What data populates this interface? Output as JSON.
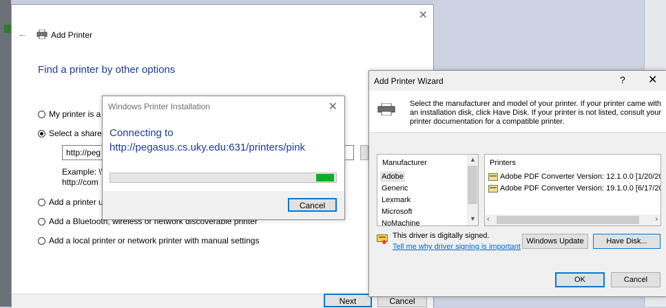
{
  "add_printer": {
    "title": "Add Printer",
    "heading": "Find a printer by other options",
    "options": [
      {
        "label": "My printer is a",
        "selected": false
      },
      {
        "label": "Select a shared",
        "selected": true
      },
      {
        "label": "Add a printer u",
        "selected": false
      },
      {
        "label": "Add a Bluetooth, wireless or network discoverable printer",
        "selected": false
      },
      {
        "label": "Add a local printer or network printer with manual settings",
        "selected": false
      }
    ],
    "url_value": "http://peg",
    "example_line1": "Example: \\\\",
    "example_line2": "http://com",
    "next_label": "Next",
    "cancel_label": "Cancel"
  },
  "install_dialog": {
    "title": "Windows Printer Installation",
    "message_line1": "Connecting to",
    "message_line2": "http://pegasus.cs.uky.edu:631/printers/pink",
    "cancel_label": "Cancel",
    "progress_fraction": 0.08
  },
  "wizard": {
    "title": "Add Printer Wizard",
    "help_glyph": "?",
    "description": "Select the manufacturer and model of your printer. If your printer came with an installation disk, click Have Disk. If your printer is not listed, consult your printer documentation for a compatible printer.",
    "manufacturer_header": "Manufacturer",
    "manufacturers": [
      "Adobe",
      "Generic",
      "Lexmark",
      "Microsoft",
      "NoMachine"
    ],
    "selected_manufacturer": "Adobe",
    "printers_header": "Printers",
    "printers": [
      "Adobe PDF Converter Version: 12.1.0.0 [1/20/20",
      "Adobe PDF Converter Version: 19.1.0.0 [6/17/20"
    ],
    "signed_text": "This driver is digitally signed.",
    "signing_link": "Tell me why driver signing is important",
    "windows_update_label": "Windows Update",
    "have_disk_label": "Have Disk...",
    "ok_label": "OK",
    "cancel_label": "Cancel"
  },
  "colors": {
    "heading_blue": "#1a3a9c",
    "progress_green": "#06b025",
    "link_blue": "#0066cc",
    "focus_blue": "#0078d7"
  }
}
